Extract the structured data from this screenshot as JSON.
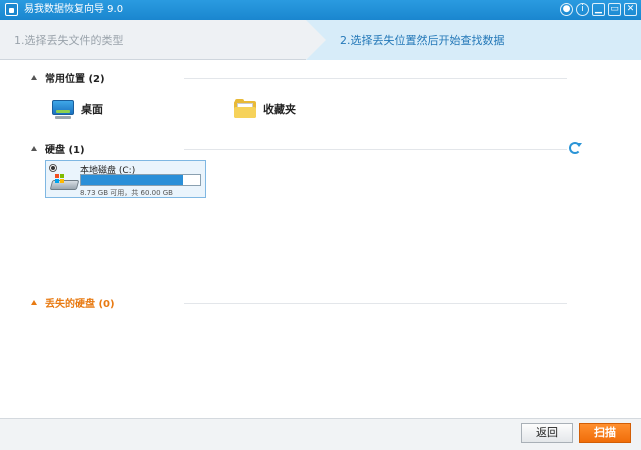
{
  "window": {
    "title": "易我数据恢复向导 9.0",
    "controls": [
      "chat-icon",
      "info-icon",
      "minimize-icon",
      "restore-icon",
      "close-icon"
    ]
  },
  "steps": {
    "step1": "1.选择丢失文件的类型",
    "step2": "2.选择丢失位置然后开始查找数据"
  },
  "common_locations": {
    "header": "常用位置 (2)",
    "items": [
      {
        "label": "桌面",
        "icon": "desktop-icon"
      },
      {
        "label": "收藏夹",
        "icon": "folder-icon"
      }
    ]
  },
  "hard_disks": {
    "header": "硬盘 (1)",
    "refresh_icon": "refresh-icon",
    "disks": [
      {
        "name": "本地磁盘 (C:)",
        "used_fraction": 0.855,
        "info": "8.73 GB 可用，共 60.00 GB",
        "selected": true
      }
    ]
  },
  "lost_disks": {
    "header": "丢失的硬盘 (0)"
  },
  "colors": {
    "accent_blue": "#1a86cf",
    "scan_orange": "#f06d0a",
    "lost_header": "#e87a12"
  },
  "footer": {
    "back_label": "返回",
    "scan_label": "扫描"
  }
}
